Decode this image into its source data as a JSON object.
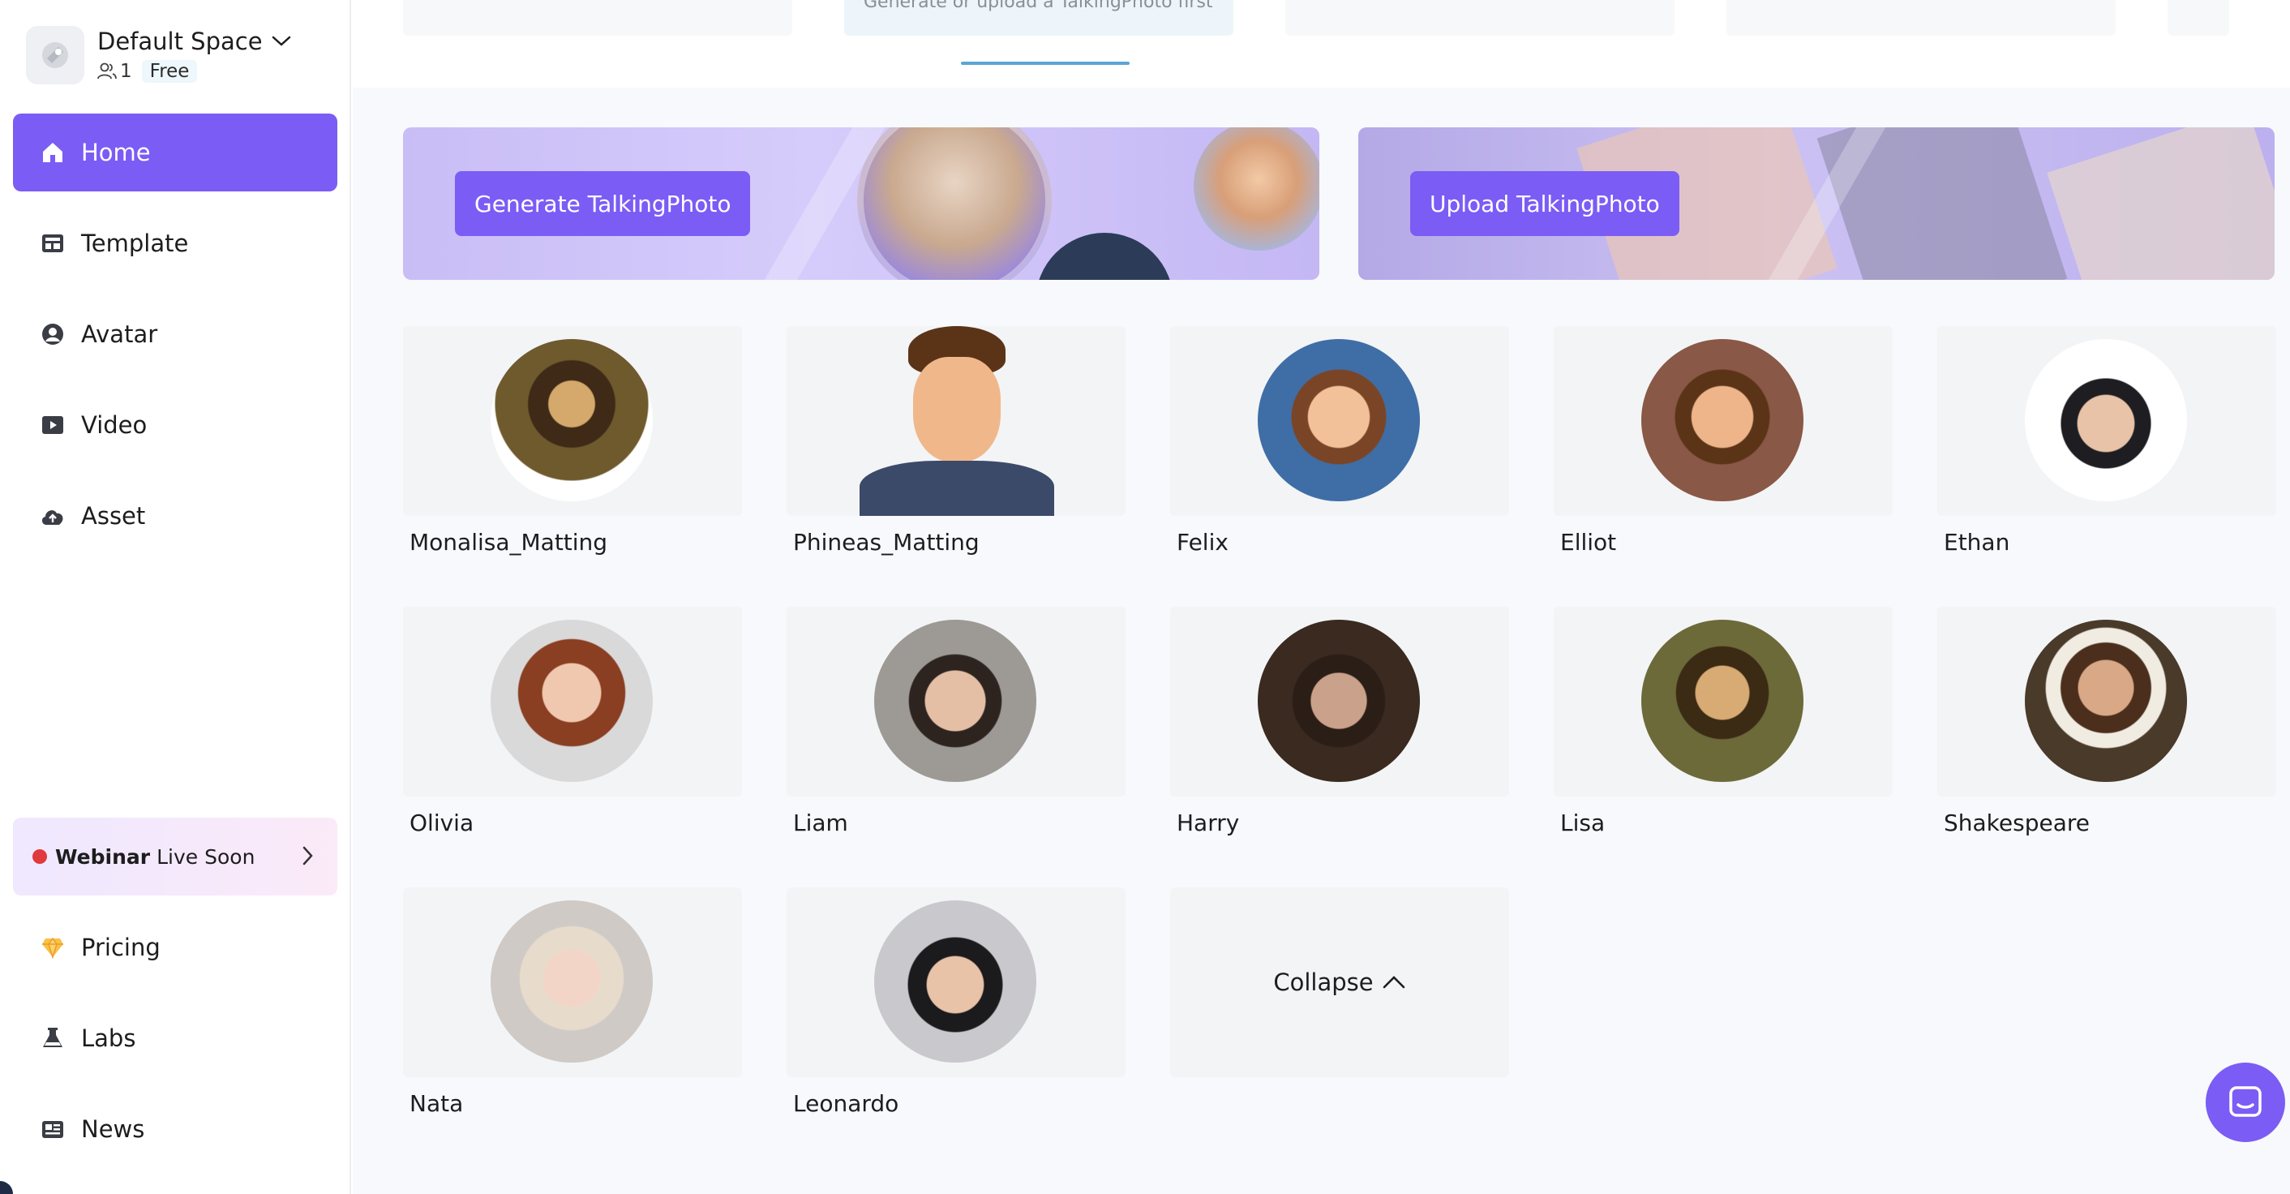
{
  "sidebar": {
    "space": {
      "name": "Default Space",
      "members": "1",
      "plan": "Free"
    },
    "nav": [
      {
        "label": "Home",
        "icon": "home-icon",
        "active": true
      },
      {
        "label": "Template",
        "icon": "template-icon",
        "active": false
      },
      {
        "label": "Avatar",
        "icon": "avatar-icon",
        "active": false
      },
      {
        "label": "Video",
        "icon": "video-icon",
        "active": false
      },
      {
        "label": "Asset",
        "icon": "cloud-upload-icon",
        "active": false
      }
    ],
    "webinar": {
      "bold": "Webinar",
      "text": "Live Soon"
    },
    "bottom_nav": [
      {
        "label": "Pricing",
        "icon": "diamond-icon"
      },
      {
        "label": "Labs",
        "icon": "flask-icon"
      },
      {
        "label": "News",
        "icon": "news-icon"
      }
    ]
  },
  "top": {
    "hint": "Generate or upload a TalkingPhoto first"
  },
  "banners": {
    "generate_label": "Generate TalkingPhoto",
    "upload_label": "Upload TalkingPhoto"
  },
  "avatars": [
    {
      "name": "Monalisa_Matting"
    },
    {
      "name": "Phineas_Matting"
    },
    {
      "name": "Felix"
    },
    {
      "name": "Elliot"
    },
    {
      "name": "Ethan"
    },
    {
      "name": "Olivia"
    },
    {
      "name": "Liam"
    },
    {
      "name": "Harry"
    },
    {
      "name": "Lisa"
    },
    {
      "name": "Shakespeare"
    },
    {
      "name": "Nata"
    },
    {
      "name": "Leonardo"
    }
  ],
  "collapse_label": "Collapse",
  "colors": {
    "accent": "#7b5cf5",
    "webinar_dot": "#e0393e"
  }
}
